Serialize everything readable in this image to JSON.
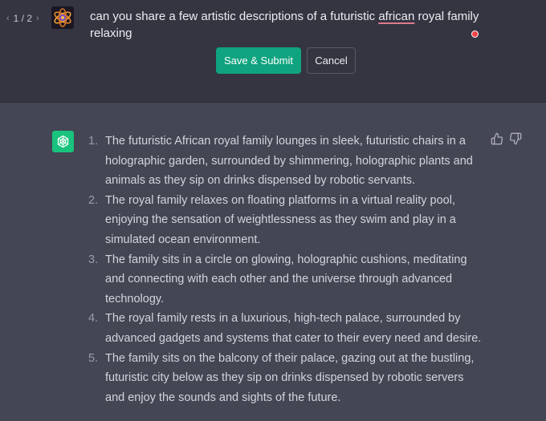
{
  "user_message": {
    "pager": {
      "current": "1 / 2"
    },
    "text_before": "can you share a few artistic descriptions of a futuristic ",
    "text_flagged": "african",
    "text_after": " royal family relaxing",
    "submit_label": "Save & Submit",
    "cancel_label": "Cancel"
  },
  "assistant_message": {
    "items": [
      {
        "number": "1.",
        "text": "The futuristic African royal family lounges in sleek, futuristic chairs in a holographic garden, surrounded by shimmering, holographic plants and animals as they sip on drinks dispensed by robotic servants."
      },
      {
        "number": "2.",
        "text": "The royal family relaxes on floating platforms in a virtual reality pool, enjoying the sensation of weightlessness as they swim and play in a simulated ocean environment."
      },
      {
        "number": "3.",
        "text": "The family sits in a circle on glowing, holographic cushions, meditating and connecting with each other and the universe through advanced technology."
      },
      {
        "number": "4.",
        "text": "The royal family rests in a luxurious, high-tech palace, surrounded by advanced gadgets and systems that cater to their every need and desire."
      },
      {
        "number": "5.",
        "text": "The family sits on the balcony of their palace, gazing out at the bustling, futuristic city below as they sip on drinks dispensed by robotic servers and enjoy the sounds and sights of the future."
      }
    ]
  },
  "colors": {
    "user_bg": "#343541",
    "assistant_bg": "#444654",
    "accent": "#10a37f",
    "openai_logo_bg": "#19c37d",
    "status_dot": "#ef4146"
  },
  "icons": {
    "prev": "chevron-left-icon",
    "next": "chevron-right-icon",
    "user_avatar": "user-avatar-image",
    "assistant_avatar": "openai-logo-icon",
    "like": "thumbs-up-icon",
    "dislike": "thumbs-down-icon"
  }
}
